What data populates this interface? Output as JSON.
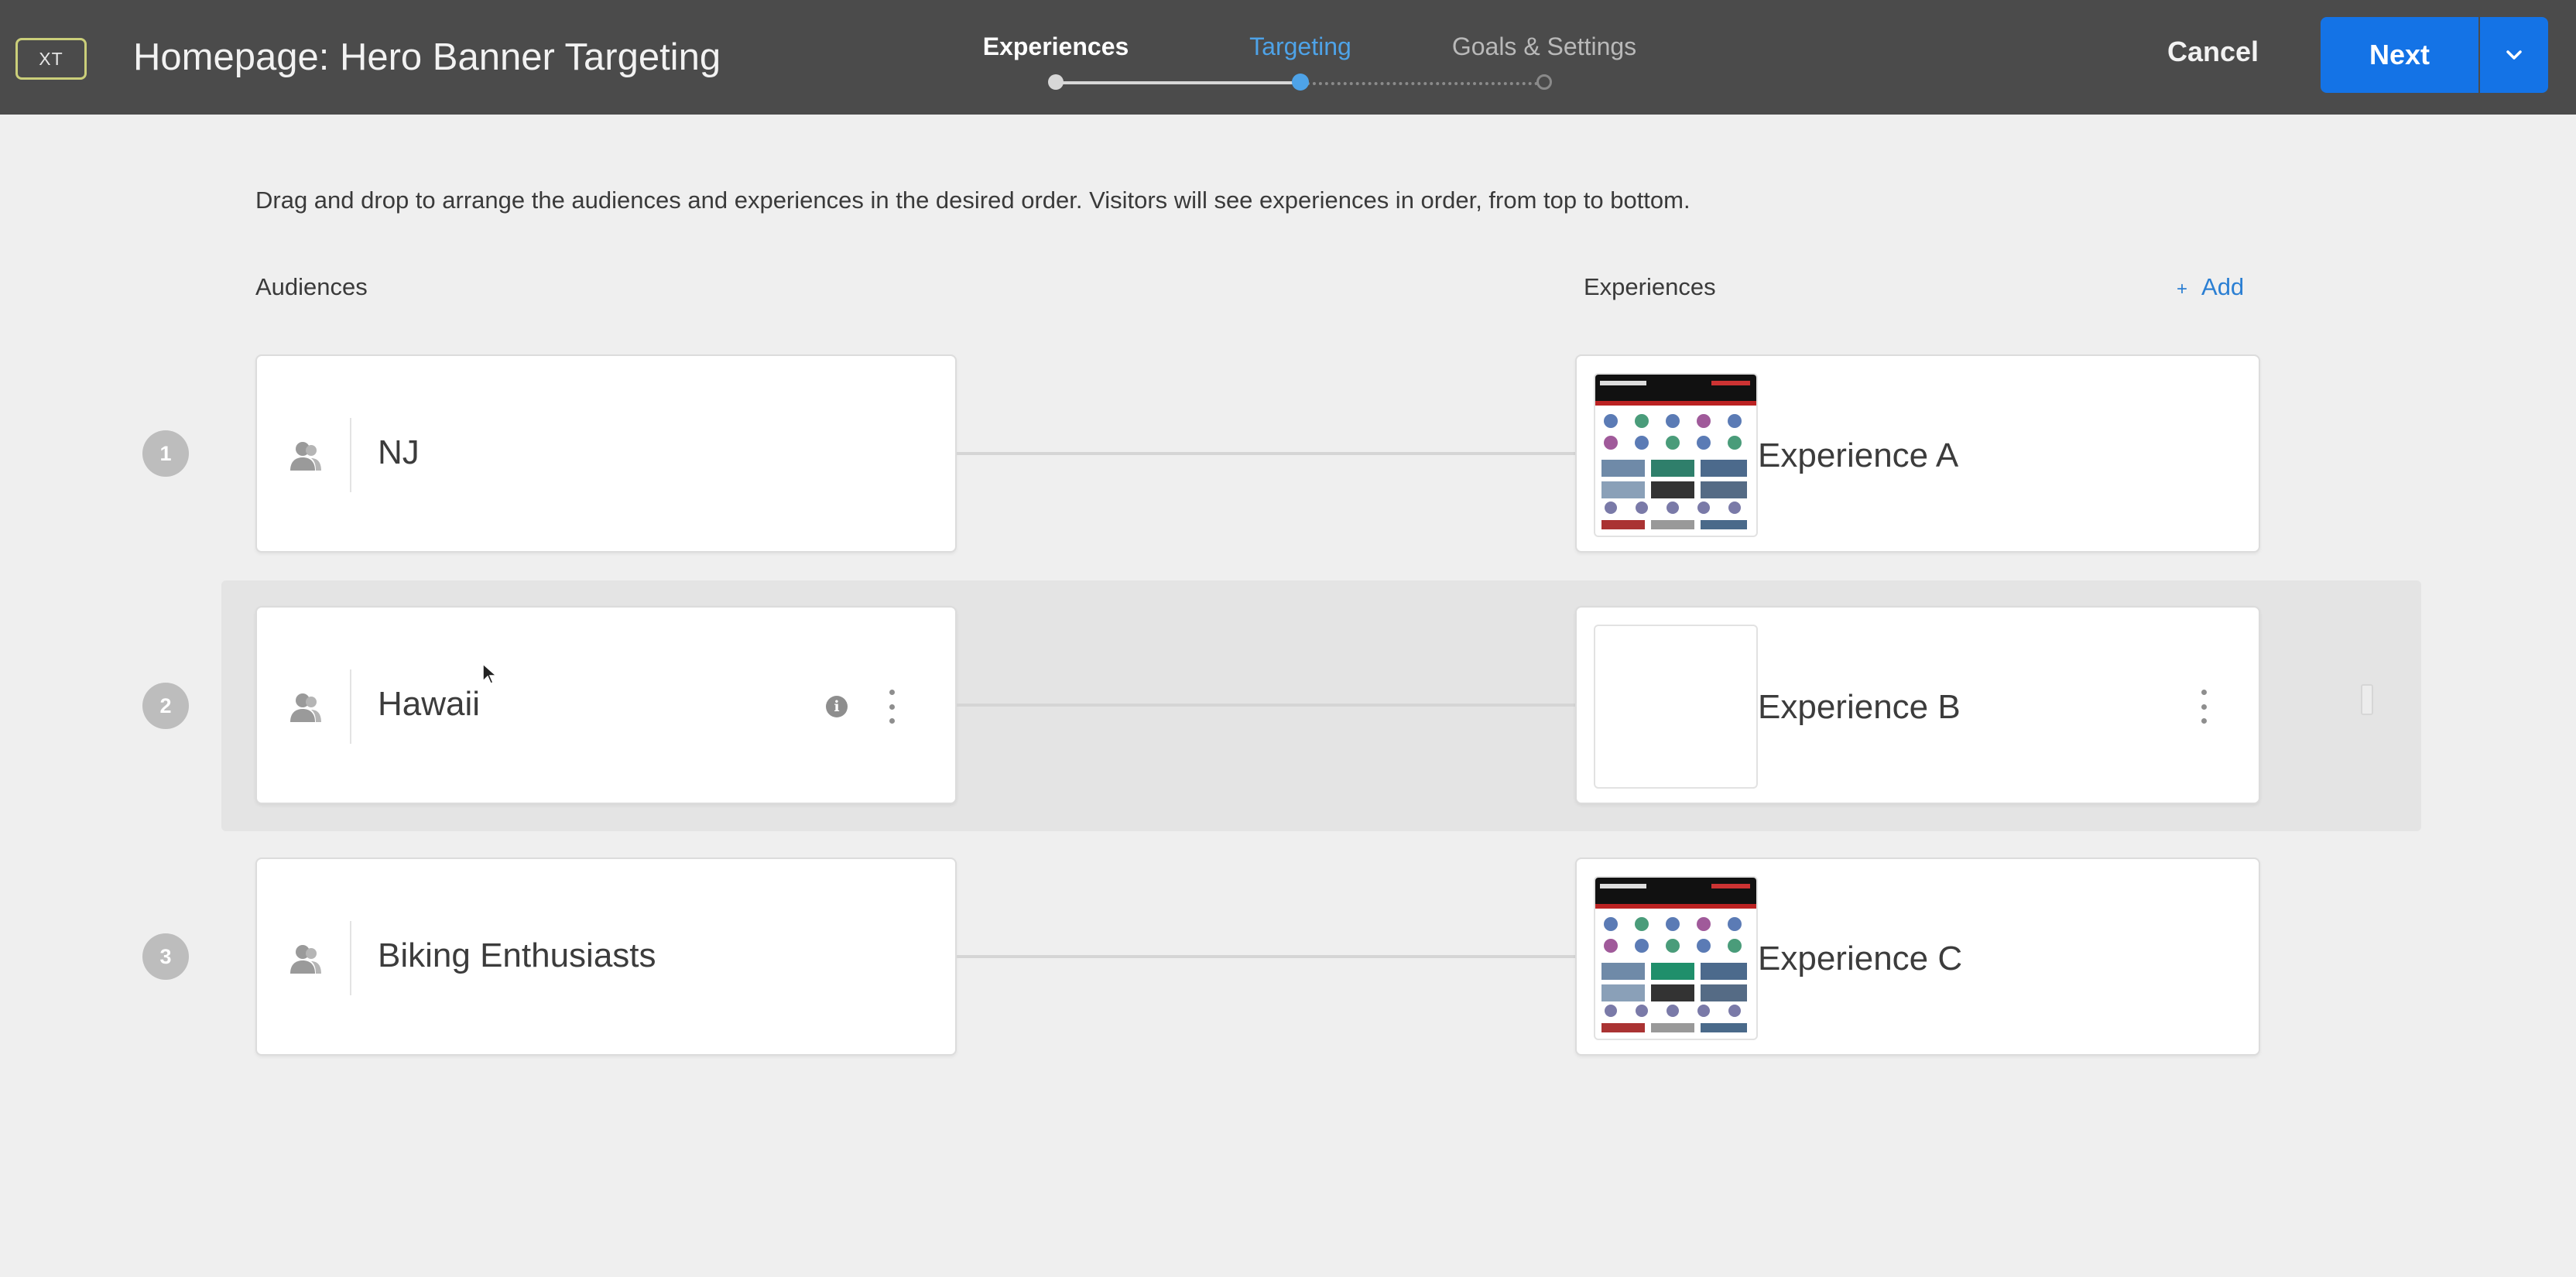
{
  "header": {
    "badge": "XT",
    "title": "Homepage: Hero Banner Targeting",
    "steps": [
      {
        "label": "Experiences",
        "state": "complete"
      },
      {
        "label": "Targeting",
        "state": "current"
      },
      {
        "label": "Goals & Settings",
        "state": "upcoming"
      }
    ],
    "cancel_label": "Cancel",
    "next_label": "Next"
  },
  "instructions": "Drag and drop to arrange the audiences and experiences in the desired order. Visitors will see experiences in order, from top to bottom.",
  "columns": {
    "audiences": "Audiences",
    "experiences": "Experiences",
    "add_label": "Add"
  },
  "rows": [
    {
      "number": "1",
      "audience": "NJ",
      "experience": "Experience A",
      "thumbnail": "page-preview",
      "highlighted": false
    },
    {
      "number": "2",
      "audience": "Hawaii",
      "experience": "Experience B",
      "thumbnail": "blank",
      "highlighted": true
    },
    {
      "number": "3",
      "audience": "Biking Enthusiasts",
      "experience": "Experience C",
      "thumbnail": "page-preview",
      "highlighted": false
    }
  ],
  "colors": {
    "header_bg": "#4b4b4b",
    "accent_blue": "#1473e6",
    "active_step": "#4ea3e8",
    "badge_outline": "#cbcf7a",
    "page_bg": "#efefef"
  },
  "icons": [
    "person-icon",
    "info-icon",
    "more-vertical-icon",
    "chevron-down-icon",
    "plus-icon",
    "drag-handle-icon",
    "mouse-pointer-icon"
  ]
}
